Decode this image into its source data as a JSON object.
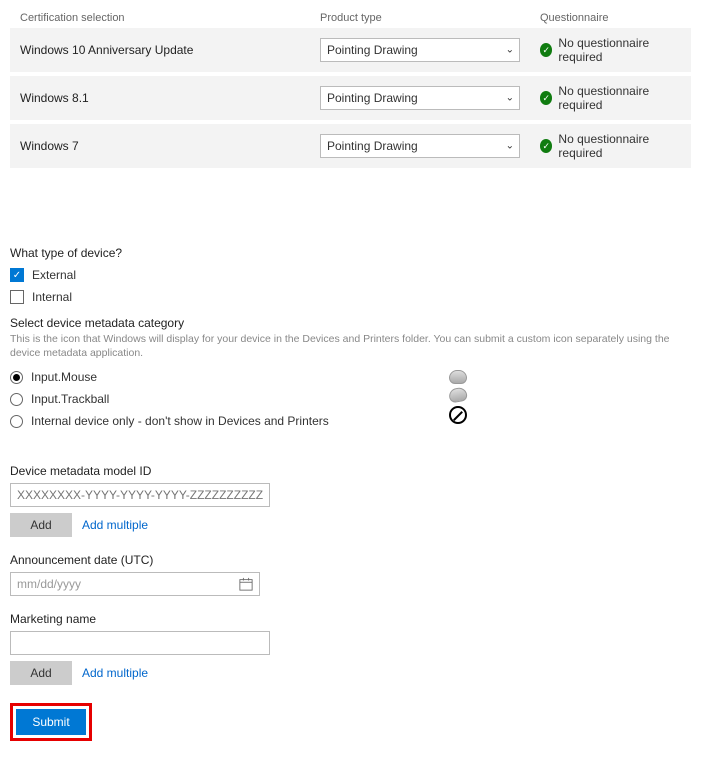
{
  "cert_header": {
    "cert": "Certification selection",
    "prod": "Product type",
    "q": "Questionnaire"
  },
  "cert_rows": [
    {
      "name": "Windows 10 Anniversary Update",
      "product": "Pointing Drawing",
      "q": "No questionnaire required"
    },
    {
      "name": "Windows 8.1",
      "product": "Pointing Drawing",
      "q": "No questionnaire required"
    },
    {
      "name": "Windows 7",
      "product": "Pointing Drawing",
      "q": "No questionnaire required"
    }
  ],
  "device_type": {
    "title": "What type of device?",
    "options": {
      "external": "External",
      "internal": "Internal"
    }
  },
  "metadata_cat": {
    "title": "Select device metadata category",
    "sub": "This is the icon that Windows will display for your device in the Devices and Printers folder. You can submit a custom icon separately using the device metadata application.",
    "radios": {
      "mouse": "Input.Mouse",
      "trackball": "Input.Trackball",
      "internal": "Internal device only - don't show in Devices and Printers"
    }
  },
  "model_id": {
    "label": "Device metadata model ID",
    "placeholder": "XXXXXXXX-YYYY-YYYY-YYYY-ZZZZZZZZZZZZ",
    "add": "Add",
    "add_multi": "Add multiple"
  },
  "announce": {
    "label": "Announcement date (UTC)",
    "placeholder": "mm/dd/yyyy"
  },
  "marketing": {
    "label": "Marketing name",
    "add": "Add",
    "add_multi": "Add multiple"
  },
  "submit": "Submit"
}
